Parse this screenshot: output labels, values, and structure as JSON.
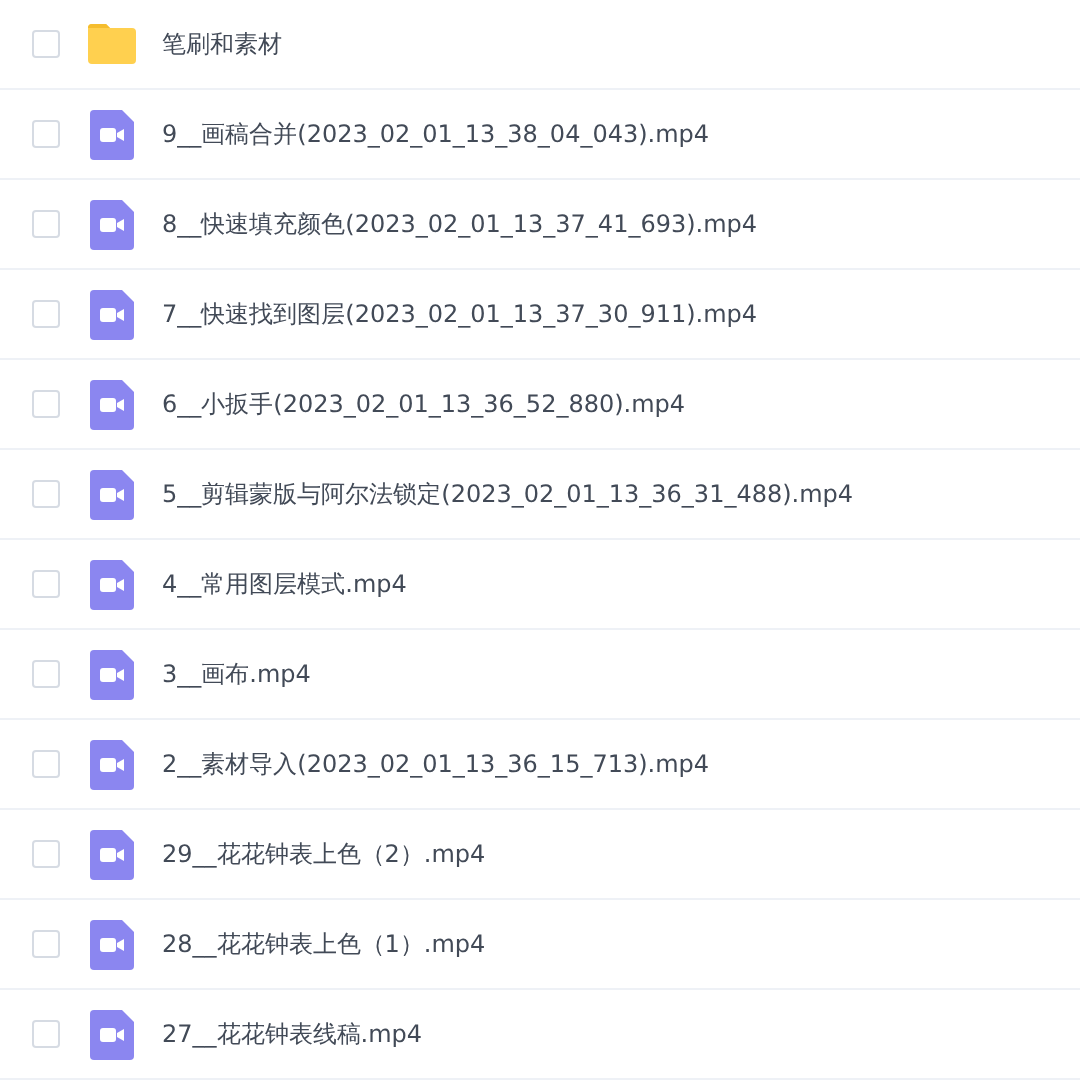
{
  "files": [
    {
      "kind": "folder",
      "name": "笔刷和素材",
      "checked": false
    },
    {
      "kind": "video",
      "name": "9__画稿合并(2023_02_01_13_38_04_043).mp4",
      "checked": false
    },
    {
      "kind": "video",
      "name": "8__快速填充颜色(2023_02_01_13_37_41_693).mp4",
      "checked": false
    },
    {
      "kind": "video",
      "name": "7__快速找到图层(2023_02_01_13_37_30_911).mp4",
      "checked": false
    },
    {
      "kind": "video",
      "name": "6__小扳手(2023_02_01_13_36_52_880).mp4",
      "checked": false
    },
    {
      "kind": "video",
      "name": "5__剪辑蒙版与阿尔法锁定(2023_02_01_13_36_31_488).mp4",
      "checked": false
    },
    {
      "kind": "video",
      "name": "4__常用图层模式.mp4",
      "checked": false
    },
    {
      "kind": "video",
      "name": "3__画布.mp4",
      "checked": false
    },
    {
      "kind": "video",
      "name": "2__素材导入(2023_02_01_13_36_15_713).mp4",
      "checked": false
    },
    {
      "kind": "video",
      "name": "29__花花钟表上色（2）.mp4",
      "checked": false
    },
    {
      "kind": "video",
      "name": "28__花花钟表上色（1）.mp4",
      "checked": false
    },
    {
      "kind": "video",
      "name": "27__花花钟表线稿.mp4",
      "checked": false
    }
  ]
}
